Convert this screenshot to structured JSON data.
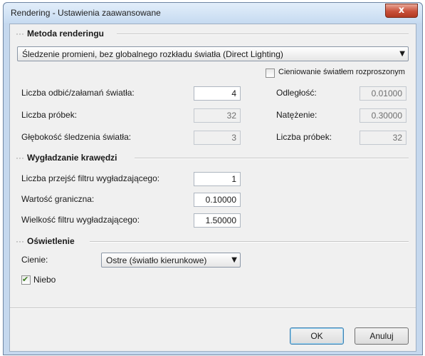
{
  "window": {
    "title": "Rendering - Ustawienia zaawansowane",
    "close_glyph": "x"
  },
  "rendering_method": {
    "header": "Metoda renderingu",
    "selected": "Śledzenie promieni, bez globalnego rozkładu światła (Direct Lighting)",
    "diffuse_shading_label": "Cieniowanie światłem rozproszonym",
    "diffuse_shading_checked": false,
    "fields": [
      {
        "label": "Liczba odbić/załamań światła:",
        "value": "4",
        "enabled": true
      },
      {
        "label": "Liczba próbek:",
        "value": "32",
        "enabled": false
      },
      {
        "label": "Głębokość śledzenia światła:",
        "value": "3",
        "enabled": false
      }
    ],
    "diffuse_fields": [
      {
        "label": "Odległość:",
        "value": "0.01000",
        "enabled": false
      },
      {
        "label": "Natężenie:",
        "value": "0.30000",
        "enabled": false
      },
      {
        "label": "Liczba próbek:",
        "value": "32",
        "enabled": false
      }
    ]
  },
  "antialiasing": {
    "header": "Wygładzanie krawędzi",
    "fields": [
      {
        "label": "Liczba przejść filtru wygładzającego:",
        "value": "1"
      },
      {
        "label": "Wartość graniczna:",
        "value": "0.10000"
      },
      {
        "label": "Wielkość filtru wygładzającego:",
        "value": "1.50000"
      }
    ]
  },
  "lighting": {
    "header": "Oświetlenie",
    "shadows_label": "Cienie:",
    "shadows_selected": "Ostre (światło kierunkowe)",
    "sky_label": "Niebo",
    "sky_checked": true
  },
  "buttons": {
    "ok": "OK",
    "cancel": "Anuluj"
  },
  "glyphs": {
    "dots": "···",
    "dropdown_arrow": "▼",
    "check": "✔"
  },
  "colors": {
    "frame": "#c5d8ee",
    "client_bg": "#f0f0f0",
    "close_button": "#c8503a"
  }
}
